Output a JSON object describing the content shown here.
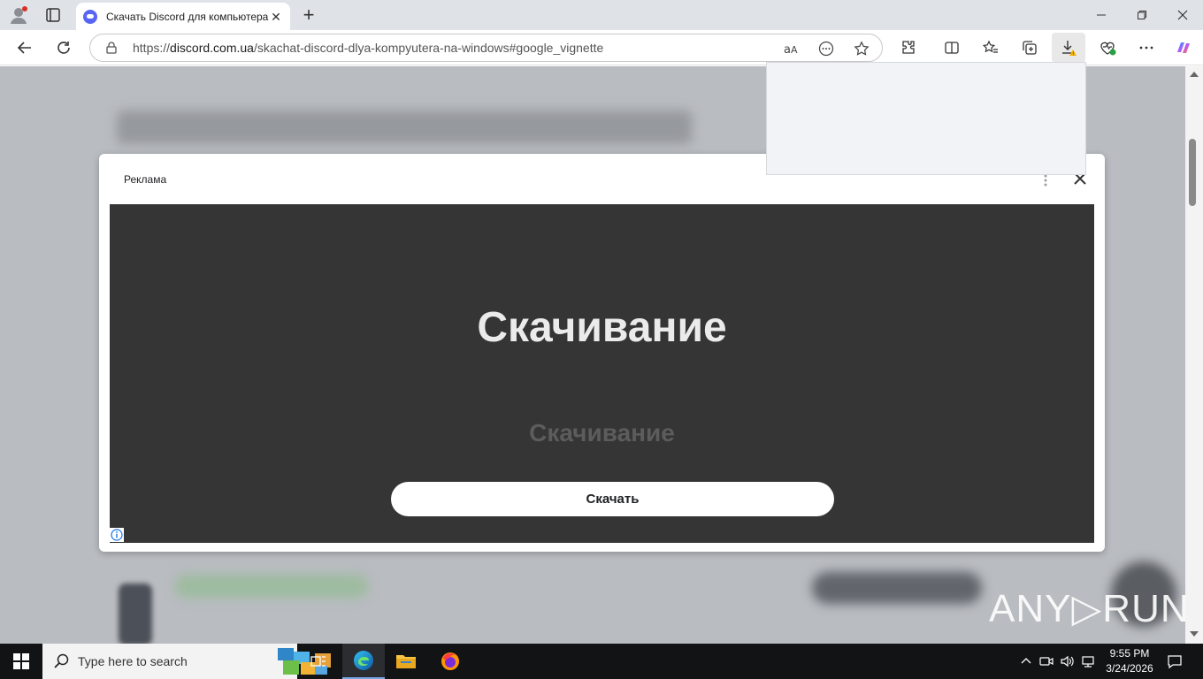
{
  "browser": {
    "tab": {
      "title": "Скачать Discord для компьютера"
    },
    "url": {
      "scheme": "https://",
      "host": "discord.com.ua",
      "path": "/skachat-discord-dlya-kompyutera-na-windows#google_vignette"
    }
  },
  "ad": {
    "label": "Реклама",
    "headline": "Скачивание",
    "subheadline": "Скачивание",
    "cta": "Скачать"
  },
  "watermark": {
    "text": "ANY▷RUN"
  },
  "taskbar": {
    "search_placeholder": "Type here to search",
    "time": "9:55 PM",
    "date": "3/24/2026"
  },
  "colors": {
    "ad_background": "#353535",
    "page_overlay": "#b9bcc1",
    "accent": "#5865f2"
  }
}
